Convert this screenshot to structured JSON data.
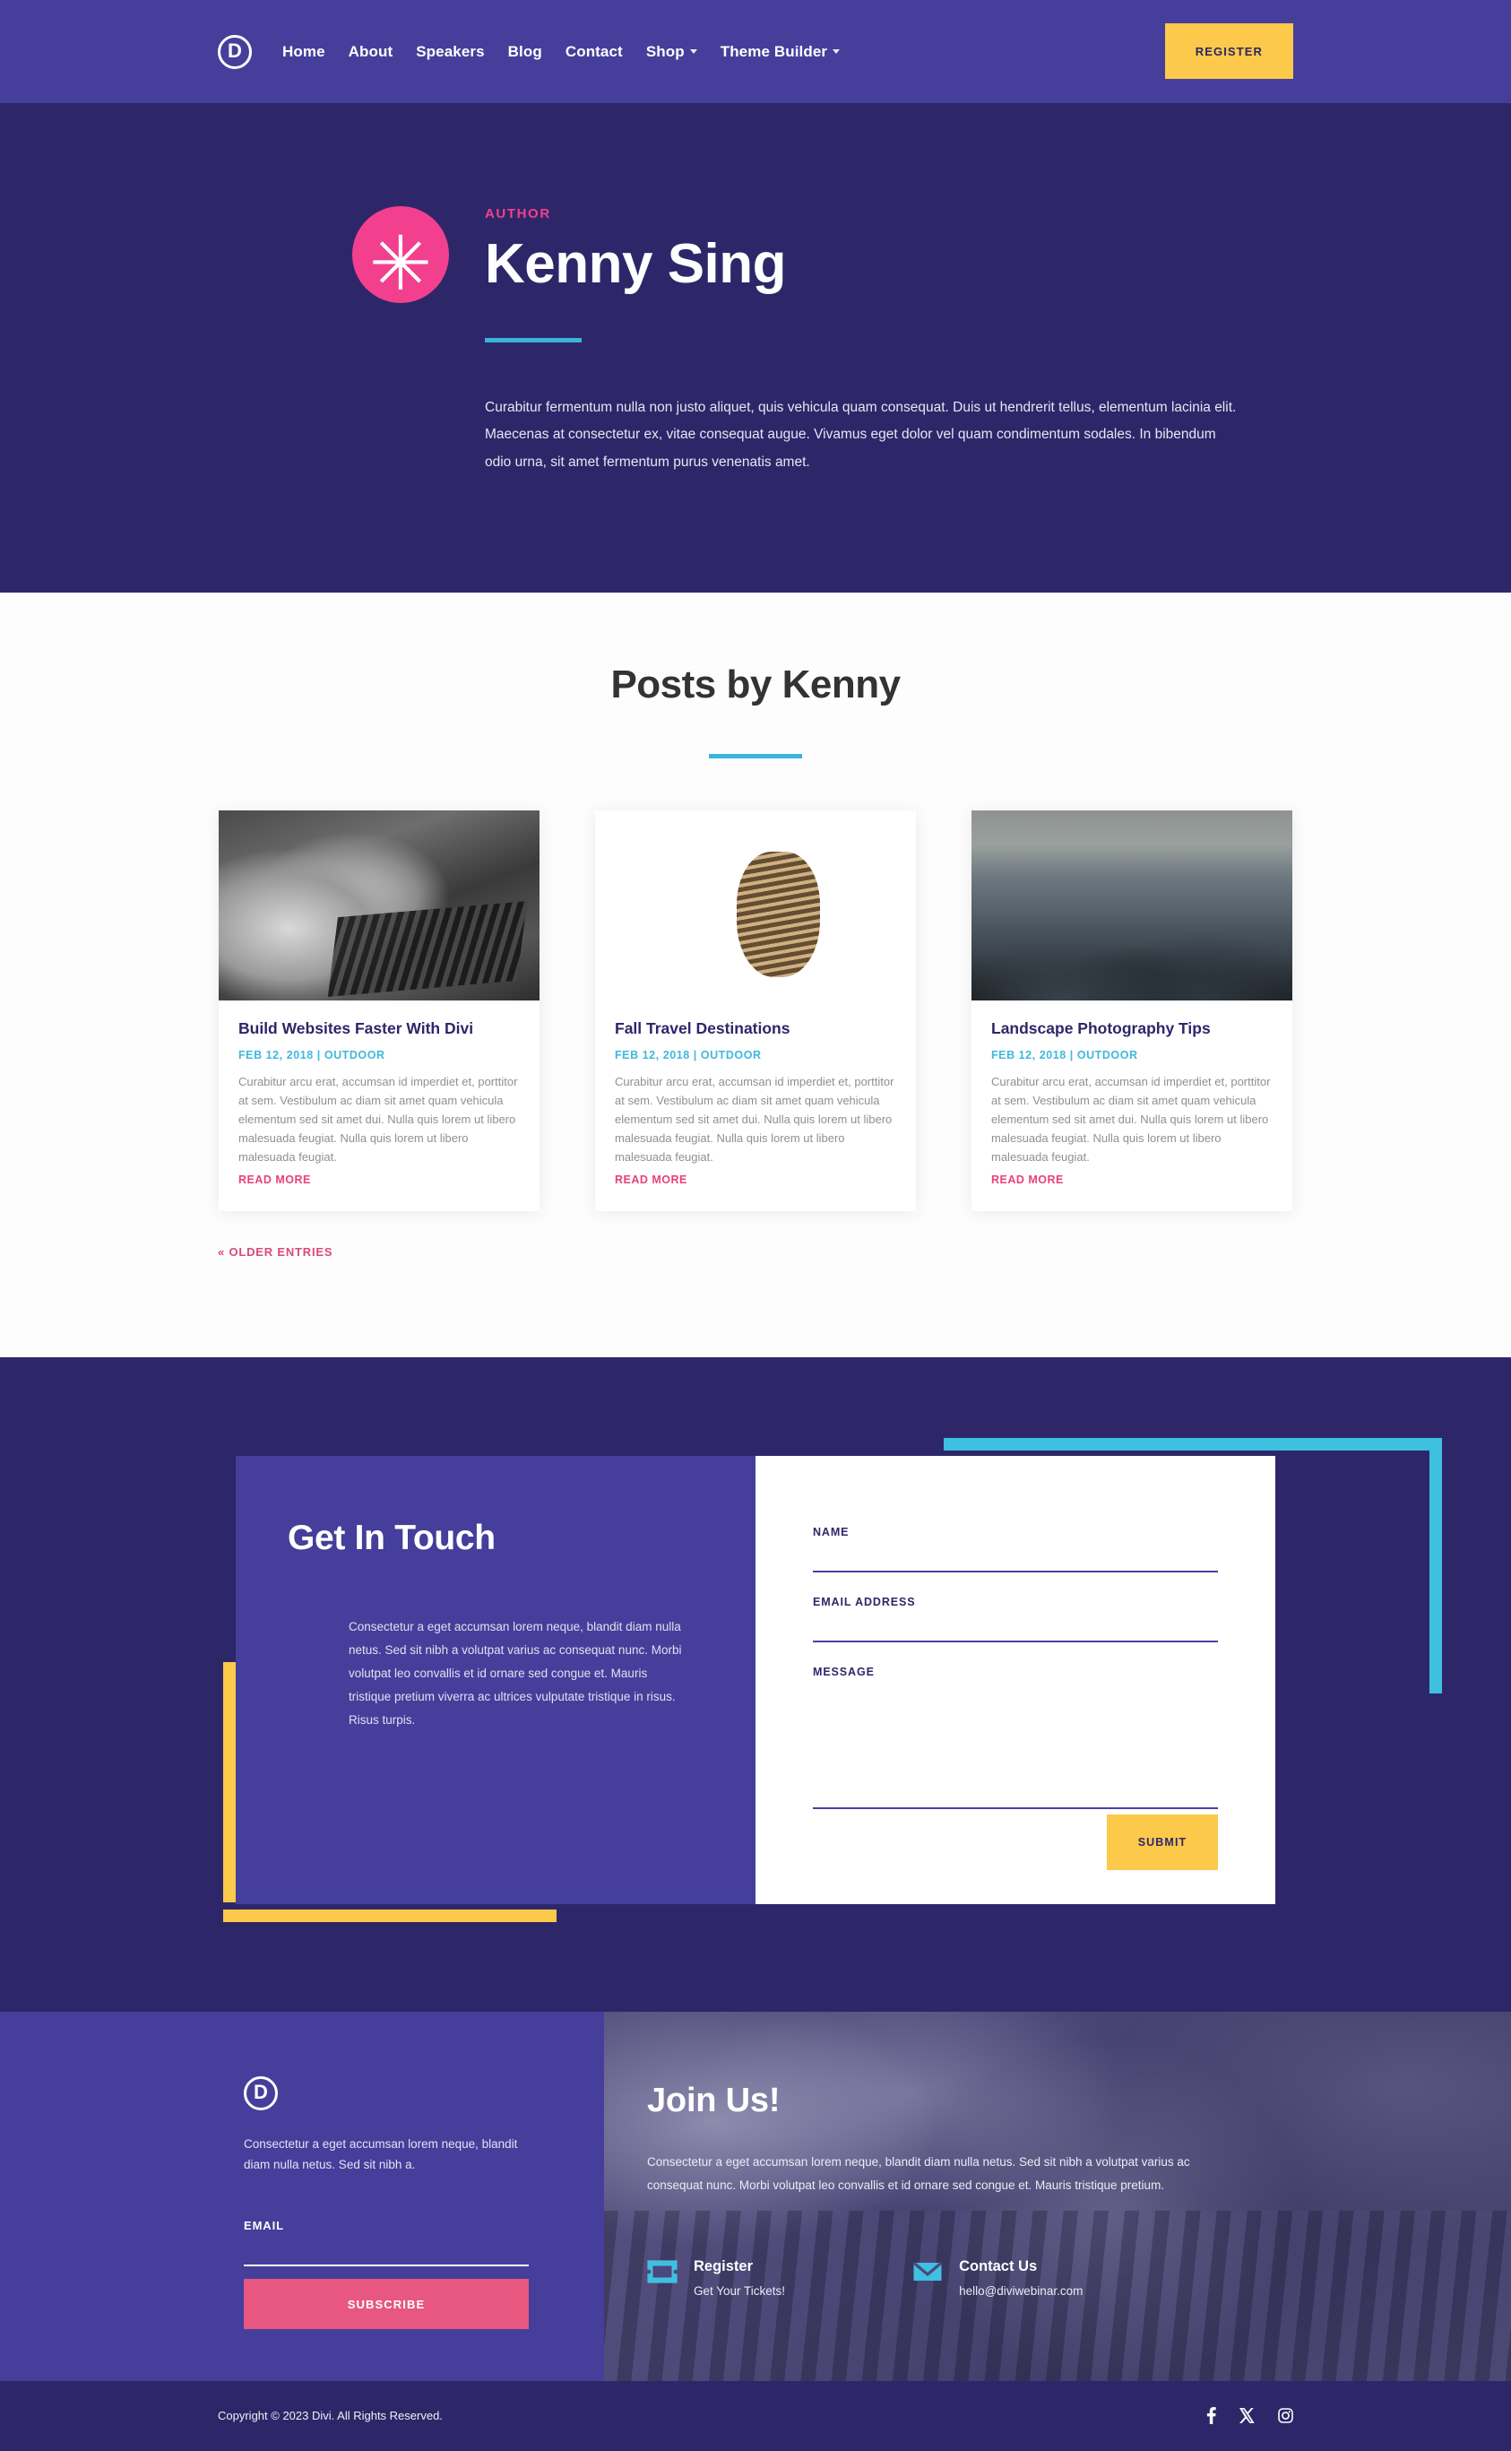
{
  "header": {
    "logo_letter": "D",
    "nav": [
      {
        "label": "Home",
        "has_caret": false
      },
      {
        "label": "About",
        "has_caret": false
      },
      {
        "label": "Speakers",
        "has_caret": false
      },
      {
        "label": "Blog",
        "has_caret": false
      },
      {
        "label": "Contact",
        "has_caret": false
      },
      {
        "label": "Shop",
        "has_caret": true
      },
      {
        "label": "Theme Builder",
        "has_caret": true
      }
    ],
    "register_label": "REGISTER",
    "bg_color": "#453f9b",
    "register_color": "#fcc94a"
  },
  "hero": {
    "avatar_glyph": "✳",
    "avatar_color": "#f3408e",
    "label": "AUTHOR",
    "name": "Kenny Sing",
    "bio": "Curabitur fermentum nulla non justo aliquet, quis vehicula quam consequat. Duis ut hendrerit tellus, elementum lacinia elit. Maecenas at consectetur ex, vitae consequat augue. Vivamus eget dolor vel quam condimentum sodales. In bibendum odio urna, sit amet fermentum purus venenatis amet.",
    "bg_color": "#2d2769",
    "rule_color": "#3ab4d9"
  },
  "posts": {
    "title": "Posts by Kenny",
    "rule_color": "#3ab4d9",
    "older_entries_label": "« OLDER ENTRIES",
    "items": [
      {
        "title": "Build Websites Faster With Divi",
        "meta": "FEB 12, 2018 | OUTDOOR",
        "excerpt": "Curabitur arcu erat, accumsan id imperdiet et, porttitor at sem. Vestibulum ac diam sit amet quam vehicula elementum sed sit amet dui. Nulla quis lorem ut libero malesuada feugiat. Nulla quis lorem ut libero malesuada feugiat.",
        "read_more": "READ MORE",
        "image": "laptop-hands-typing"
      },
      {
        "title": "Fall Travel Destinations",
        "meta": "FEB 12, 2018 | OUTDOOR",
        "excerpt": "Curabitur arcu erat, accumsan id imperdiet et, porttitor at sem. Vestibulum ac diam sit amet quam vehicula elementum sed sit amet dui. Nulla quis lorem ut libero malesuada feugiat. Nulla quis lorem ut libero malesuada feugiat.",
        "read_more": "READ MORE",
        "image": "pine-cone"
      },
      {
        "title": "Landscape Photography Tips",
        "meta": "FEB 12, 2018 | OUTDOOR",
        "excerpt": "Curabitur arcu erat, accumsan id imperdiet et, porttitor at sem. Vestibulum ac diam sit amet quam vehicula elementum sed sit amet dui. Nulla quis lorem ut libero malesuada feugiat. Nulla quis lorem ut libero malesuada feugiat.",
        "read_more": "READ MORE",
        "image": "mountain-range"
      }
    ]
  },
  "contact": {
    "title": "Get In Touch",
    "copy": "Consectetur a eget accumsan lorem neque, blandit diam nulla netus. Sed sit nibh a volutpat varius ac consequat nunc. Morbi volutpat leo convallis et id ornare sed congue et. Mauris tristique pretium viverra ac ultrices vulputate tristique in risus. Risus turpis.",
    "fields": {
      "name_label": "NAME",
      "name_value": "",
      "email_label": "EMAIL ADDRESS",
      "email_value": "",
      "message_label": "MESSAGE",
      "message_value": ""
    },
    "submit_label": "SUBMIT",
    "deco_yellow": "#fcc94a",
    "deco_cyan": "#3fc0e0",
    "panel_color": "#453f9b"
  },
  "footer": {
    "logo_letter": "D",
    "blurb": "Consectetur a eget accumsan lorem neque, blandit diam nulla netus. Sed sit nibh a.",
    "email_label": "EMAIL",
    "email_value": "",
    "subscribe_label": "SUBSCRIBE",
    "subscribe_color": "#e8577f",
    "join": {
      "title": "Join Us!",
      "copy": "Consectetur a eget accumsan lorem neque, blandit diam nulla netus. Sed sit nibh a volutpat varius ac consequat nunc. Morbi volutpat leo convallis et id ornare sed congue et. Mauris tristique pretium.",
      "links": [
        {
          "icon": "ticket-icon",
          "title": "Register",
          "sub": "Get Your Tickets!"
        },
        {
          "icon": "envelope-icon",
          "title": "Contact Us",
          "sub": "hello@diviwebinar.com"
        }
      ]
    },
    "copyright": "Copyright © 2023 Divi. All Rights Reserved.",
    "socials": [
      {
        "name": "facebook-icon",
        "glyph": "f"
      },
      {
        "name": "x-twitter-icon",
        "glyph": "𝕏"
      },
      {
        "name": "instagram-icon",
        "glyph": "◻"
      }
    ]
  }
}
